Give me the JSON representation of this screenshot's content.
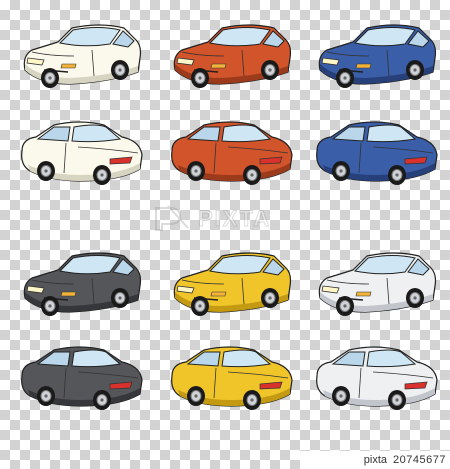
{
  "image": {
    "description_free": true,
    "background": "transparency-checkerboard",
    "checker_color": "#d3d3d3"
  },
  "cars": [
    {
      "view": "front",
      "body": "#fbf8ec",
      "shade": "#d8d4c2"
    },
    {
      "view": "front",
      "body": "#d2542a",
      "shade": "#9c3a1c"
    },
    {
      "view": "front",
      "body": "#3a5ea8",
      "shade": "#27407a"
    },
    {
      "view": "rear",
      "body": "#fbf8ec",
      "shade": "#d8d4c2"
    },
    {
      "view": "rear",
      "body": "#d2542a",
      "shade": "#9c3a1c"
    },
    {
      "view": "rear",
      "body": "#3a5ea8",
      "shade": "#27407a"
    },
    {
      "view": "front",
      "body": "#55565a",
      "shade": "#36373a"
    },
    {
      "view": "front",
      "body": "#f0c52a",
      "shade": "#c49a12"
    },
    {
      "view": "front",
      "body": "#eef0f2",
      "shade": "#c2c6cc"
    },
    {
      "view": "rear",
      "body": "#55565a",
      "shade": "#36373a"
    },
    {
      "view": "rear",
      "body": "#f0c52a",
      "shade": "#c49a12"
    },
    {
      "view": "rear",
      "body": "#eef0f2",
      "shade": "#c2c6cc"
    }
  ],
  "watermark": {
    "text": "PIXTA"
  },
  "footer": {
    "brand": "pixta",
    "id": "20745677"
  }
}
